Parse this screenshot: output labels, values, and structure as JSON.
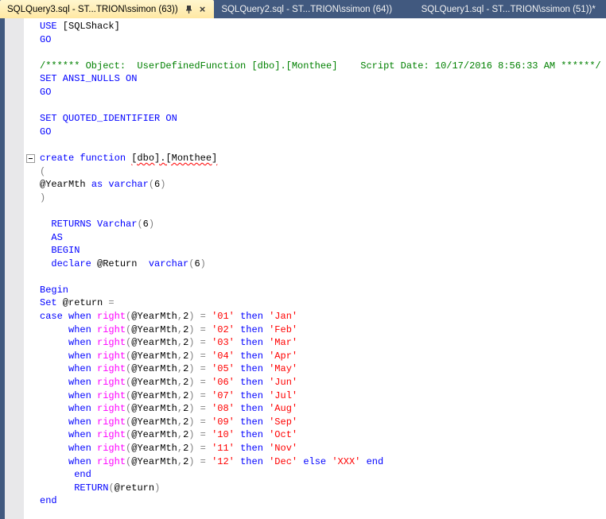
{
  "tab_bar": {
    "close_glyph": "×",
    "tabs": [
      {
        "id": "sqlquery3",
        "label": "SQLQuery3.sql - ST...TRION\\ssimon (63))",
        "active": true
      },
      {
        "id": "sqlquery2",
        "label": "SQLQuery2.sql - ST...TRION\\ssimon (64))",
        "active": false
      },
      {
        "id": "sqlquery1",
        "label": "SQLQuery1.sql - ST...TRION\\ssimon (51))*",
        "active": false
      }
    ]
  },
  "colors": {
    "tab_bar_bg": "#41597f",
    "active_tab_bg": "#ffe8a3",
    "keyword": "#0000ff",
    "comment": "#008000",
    "string": "#ff0000",
    "system_function": "#ff00ff",
    "operator": "#808080",
    "text": "#000000",
    "error_underline": "#ff0000"
  },
  "editor": {
    "fold_markers": [
      10
    ],
    "lines": [
      [
        [
          "kw",
          "USE"
        ],
        [
          "pl",
          " [SQLShack]"
        ]
      ],
      [
        [
          "kw",
          "GO"
        ]
      ],
      [],
      [
        [
          "cm",
          "/****** Object:  UserDefinedFunction [dbo].[Monthee]    Script Date: 10/17/2016 8:56:33 AM ******/"
        ]
      ],
      [
        [
          "kw",
          "SET ANSI_NULLS ON"
        ]
      ],
      [
        [
          "kw",
          "GO"
        ]
      ],
      [],
      [
        [
          "kw",
          "SET QUOTED_IDENTIFIER ON"
        ]
      ],
      [
        [
          "kw",
          "GO"
        ]
      ],
      [],
      [
        [
          "kw",
          "create function"
        ],
        [
          "pl",
          " "
        ],
        [
          "err",
          "[dbo].[Monthee]"
        ]
      ],
      [
        [
          "op",
          "("
        ]
      ],
      [
        [
          "pl",
          "@YearMth "
        ],
        [
          "kw",
          "as"
        ],
        [
          "pl",
          " "
        ],
        [
          "kw",
          "varchar"
        ],
        [
          "op",
          "("
        ],
        [
          "pl",
          "6"
        ],
        [
          "op",
          ")"
        ]
      ],
      [
        [
          "op",
          ")"
        ]
      ],
      [],
      [
        [
          "pl",
          "  "
        ],
        [
          "kw",
          "RETURNS"
        ],
        [
          "pl",
          " "
        ],
        [
          "kw",
          "Varchar"
        ],
        [
          "op",
          "("
        ],
        [
          "pl",
          "6"
        ],
        [
          "op",
          ")"
        ]
      ],
      [
        [
          "pl",
          "  "
        ],
        [
          "kw",
          "AS"
        ]
      ],
      [
        [
          "pl",
          "  "
        ],
        [
          "kw",
          "BEGIN"
        ]
      ],
      [
        [
          "pl",
          "  "
        ],
        [
          "kw",
          "declare"
        ],
        [
          "pl",
          " @Return  "
        ],
        [
          "kw",
          "varchar"
        ],
        [
          "op",
          "("
        ],
        [
          "pl",
          "6"
        ],
        [
          "op",
          ")"
        ]
      ],
      [],
      [
        [
          "kw",
          "Begin"
        ]
      ],
      [
        [
          "kw",
          "Set"
        ],
        [
          "pl",
          " @return "
        ],
        [
          "op",
          "="
        ]
      ],
      [
        [
          "kw",
          "case"
        ],
        [
          "pl",
          " "
        ],
        [
          "kw",
          "when"
        ],
        [
          "pl",
          " "
        ],
        [
          "fn",
          "right"
        ],
        [
          "op",
          "("
        ],
        [
          "pl",
          "@YearMth"
        ],
        [
          "op",
          ","
        ],
        [
          "pl",
          "2"
        ],
        [
          "op",
          ")"
        ],
        [
          "pl",
          " "
        ],
        [
          "op",
          "="
        ],
        [
          "pl",
          " "
        ],
        [
          "str",
          "'01'"
        ],
        [
          "pl",
          " "
        ],
        [
          "kw",
          "then"
        ],
        [
          "pl",
          " "
        ],
        [
          "str",
          "'Jan'"
        ]
      ],
      [
        [
          "pl",
          "     "
        ],
        [
          "kw",
          "when"
        ],
        [
          "pl",
          " "
        ],
        [
          "fn",
          "right"
        ],
        [
          "op",
          "("
        ],
        [
          "pl",
          "@YearMth"
        ],
        [
          "op",
          ","
        ],
        [
          "pl",
          "2"
        ],
        [
          "op",
          ")"
        ],
        [
          "pl",
          " "
        ],
        [
          "op",
          "="
        ],
        [
          "pl",
          " "
        ],
        [
          "str",
          "'02'"
        ],
        [
          "pl",
          " "
        ],
        [
          "kw",
          "then"
        ],
        [
          "pl",
          " "
        ],
        [
          "str",
          "'Feb'"
        ]
      ],
      [
        [
          "pl",
          "     "
        ],
        [
          "kw",
          "when"
        ],
        [
          "pl",
          " "
        ],
        [
          "fn",
          "right"
        ],
        [
          "op",
          "("
        ],
        [
          "pl",
          "@YearMth"
        ],
        [
          "op",
          ","
        ],
        [
          "pl",
          "2"
        ],
        [
          "op",
          ")"
        ],
        [
          "pl",
          " "
        ],
        [
          "op",
          "="
        ],
        [
          "pl",
          " "
        ],
        [
          "str",
          "'03'"
        ],
        [
          "pl",
          " "
        ],
        [
          "kw",
          "then"
        ],
        [
          "pl",
          " "
        ],
        [
          "str",
          "'Mar'"
        ]
      ],
      [
        [
          "pl",
          "     "
        ],
        [
          "kw",
          "when"
        ],
        [
          "pl",
          " "
        ],
        [
          "fn",
          "right"
        ],
        [
          "op",
          "("
        ],
        [
          "pl",
          "@YearMth"
        ],
        [
          "op",
          ","
        ],
        [
          "pl",
          "2"
        ],
        [
          "op",
          ")"
        ],
        [
          "pl",
          " "
        ],
        [
          "op",
          "="
        ],
        [
          "pl",
          " "
        ],
        [
          "str",
          "'04'"
        ],
        [
          "pl",
          " "
        ],
        [
          "kw",
          "then"
        ],
        [
          "pl",
          " "
        ],
        [
          "str",
          "'Apr'"
        ]
      ],
      [
        [
          "pl",
          "     "
        ],
        [
          "kw",
          "when"
        ],
        [
          "pl",
          " "
        ],
        [
          "fn",
          "right"
        ],
        [
          "op",
          "("
        ],
        [
          "pl",
          "@YearMth"
        ],
        [
          "op",
          ","
        ],
        [
          "pl",
          "2"
        ],
        [
          "op",
          ")"
        ],
        [
          "pl",
          " "
        ],
        [
          "op",
          "="
        ],
        [
          "pl",
          " "
        ],
        [
          "str",
          "'05'"
        ],
        [
          "pl",
          " "
        ],
        [
          "kw",
          "then"
        ],
        [
          "pl",
          " "
        ],
        [
          "str",
          "'May'"
        ]
      ],
      [
        [
          "pl",
          "     "
        ],
        [
          "kw",
          "when"
        ],
        [
          "pl",
          " "
        ],
        [
          "fn",
          "right"
        ],
        [
          "op",
          "("
        ],
        [
          "pl",
          "@YearMth"
        ],
        [
          "op",
          ","
        ],
        [
          "pl",
          "2"
        ],
        [
          "op",
          ")"
        ],
        [
          "pl",
          " "
        ],
        [
          "op",
          "="
        ],
        [
          "pl",
          " "
        ],
        [
          "str",
          "'06'"
        ],
        [
          "pl",
          " "
        ],
        [
          "kw",
          "then"
        ],
        [
          "pl",
          " "
        ],
        [
          "str",
          "'Jun'"
        ]
      ],
      [
        [
          "pl",
          "     "
        ],
        [
          "kw",
          "when"
        ],
        [
          "pl",
          " "
        ],
        [
          "fn",
          "right"
        ],
        [
          "op",
          "("
        ],
        [
          "pl",
          "@YearMth"
        ],
        [
          "op",
          ","
        ],
        [
          "pl",
          "2"
        ],
        [
          "op",
          ")"
        ],
        [
          "pl",
          " "
        ],
        [
          "op",
          "="
        ],
        [
          "pl",
          " "
        ],
        [
          "str",
          "'07'"
        ],
        [
          "pl",
          " "
        ],
        [
          "kw",
          "then"
        ],
        [
          "pl",
          " "
        ],
        [
          "str",
          "'Jul'"
        ]
      ],
      [
        [
          "pl",
          "     "
        ],
        [
          "kw",
          "when"
        ],
        [
          "pl",
          " "
        ],
        [
          "fn",
          "right"
        ],
        [
          "op",
          "("
        ],
        [
          "pl",
          "@YearMth"
        ],
        [
          "op",
          ","
        ],
        [
          "pl",
          "2"
        ],
        [
          "op",
          ")"
        ],
        [
          "pl",
          " "
        ],
        [
          "op",
          "="
        ],
        [
          "pl",
          " "
        ],
        [
          "str",
          "'08'"
        ],
        [
          "pl",
          " "
        ],
        [
          "kw",
          "then"
        ],
        [
          "pl",
          " "
        ],
        [
          "str",
          "'Aug'"
        ]
      ],
      [
        [
          "pl",
          "     "
        ],
        [
          "kw",
          "when"
        ],
        [
          "pl",
          " "
        ],
        [
          "fn",
          "right"
        ],
        [
          "op",
          "("
        ],
        [
          "pl",
          "@YearMth"
        ],
        [
          "op",
          ","
        ],
        [
          "pl",
          "2"
        ],
        [
          "op",
          ")"
        ],
        [
          "pl",
          " "
        ],
        [
          "op",
          "="
        ],
        [
          "pl",
          " "
        ],
        [
          "str",
          "'09'"
        ],
        [
          "pl",
          " "
        ],
        [
          "kw",
          "then"
        ],
        [
          "pl",
          " "
        ],
        [
          "str",
          "'Sep'"
        ]
      ],
      [
        [
          "pl",
          "     "
        ],
        [
          "kw",
          "when"
        ],
        [
          "pl",
          " "
        ],
        [
          "fn",
          "right"
        ],
        [
          "op",
          "("
        ],
        [
          "pl",
          "@YearMth"
        ],
        [
          "op",
          ","
        ],
        [
          "pl",
          "2"
        ],
        [
          "op",
          ")"
        ],
        [
          "pl",
          " "
        ],
        [
          "op",
          "="
        ],
        [
          "pl",
          " "
        ],
        [
          "str",
          "'10'"
        ],
        [
          "pl",
          " "
        ],
        [
          "kw",
          "then"
        ],
        [
          "pl",
          " "
        ],
        [
          "str",
          "'Oct'"
        ]
      ],
      [
        [
          "pl",
          "     "
        ],
        [
          "kw",
          "when"
        ],
        [
          "pl",
          " "
        ],
        [
          "fn",
          "right"
        ],
        [
          "op",
          "("
        ],
        [
          "pl",
          "@YearMth"
        ],
        [
          "op",
          ","
        ],
        [
          "pl",
          "2"
        ],
        [
          "op",
          ")"
        ],
        [
          "pl",
          " "
        ],
        [
          "op",
          "="
        ],
        [
          "pl",
          " "
        ],
        [
          "str",
          "'11'"
        ],
        [
          "pl",
          " "
        ],
        [
          "kw",
          "then"
        ],
        [
          "pl",
          " "
        ],
        [
          "str",
          "'Nov'"
        ]
      ],
      [
        [
          "pl",
          "     "
        ],
        [
          "kw",
          "when"
        ],
        [
          "pl",
          " "
        ],
        [
          "fn",
          "right"
        ],
        [
          "op",
          "("
        ],
        [
          "pl",
          "@YearMth"
        ],
        [
          "op",
          ","
        ],
        [
          "pl",
          "2"
        ],
        [
          "op",
          ")"
        ],
        [
          "pl",
          " "
        ],
        [
          "op",
          "="
        ],
        [
          "pl",
          " "
        ],
        [
          "str",
          "'12'"
        ],
        [
          "pl",
          " "
        ],
        [
          "kw",
          "then"
        ],
        [
          "pl",
          " "
        ],
        [
          "str",
          "'Dec'"
        ],
        [
          "pl",
          " "
        ],
        [
          "kw",
          "else"
        ],
        [
          "pl",
          " "
        ],
        [
          "str",
          "'XXX'"
        ],
        [
          "pl",
          " "
        ],
        [
          "kw",
          "end"
        ]
      ],
      [
        [
          "pl",
          "      "
        ],
        [
          "kw",
          "end"
        ]
      ],
      [
        [
          "pl",
          "      "
        ],
        [
          "kw",
          "RETURN"
        ],
        [
          "op",
          "("
        ],
        [
          "pl",
          "@return"
        ],
        [
          "op",
          ")"
        ]
      ],
      [
        [
          "kw",
          "end"
        ]
      ]
    ]
  }
}
